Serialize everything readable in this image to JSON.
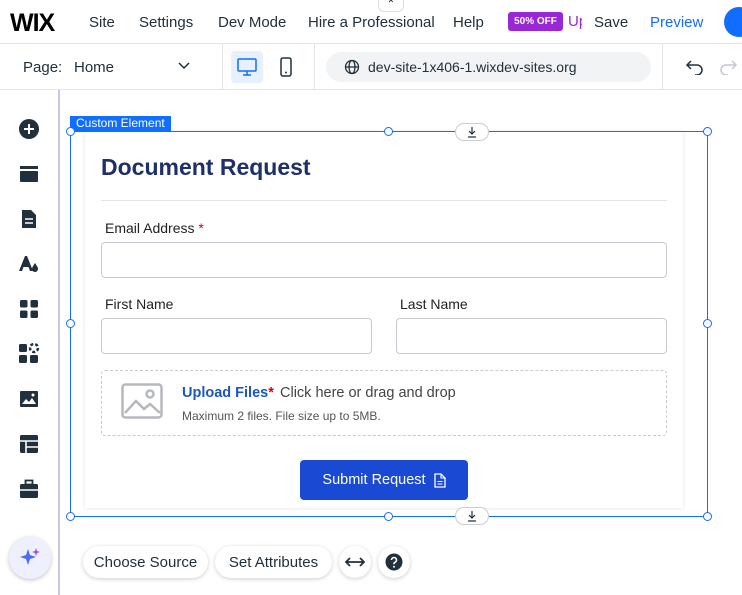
{
  "topbar": {
    "logo": "WIX",
    "menu": [
      "Site",
      "Settings",
      "Dev Mode",
      "Hire a Professional",
      "Help"
    ],
    "promo_badge": "50% OFF",
    "upgrade_label": "Upgrade",
    "save_label": "Save",
    "preview_label": "Preview",
    "collapse_glyph": "⌃"
  },
  "subbar": {
    "page_label": "Page:",
    "page_value": "Home",
    "url": "dev-site-1x406-1.wixdev-sites.org"
  },
  "selection": {
    "label": "Custom Element"
  },
  "form": {
    "title": "Document Request",
    "email_label": "Email Address",
    "required_mark": "*",
    "first_name_label": "First Name",
    "last_name_label": "Last Name",
    "upload_title": "Upload Files",
    "upload_hint": "Click here or drag and drop",
    "upload_limits": "Maximum 2 files.  File size up to 5MB.",
    "submit_label": "Submit Request"
  },
  "floating_toolbar": {
    "choose_source": "Choose Source",
    "set_attributes": "Set Attributes"
  },
  "colors": {
    "accent": "#116dff",
    "promo": "#9a27d5",
    "form_title": "#1e2f6b",
    "submit": "#1a49d3"
  },
  "icons": [
    "add-icon",
    "pages-icon",
    "blog-icon",
    "design-icon",
    "apps-icon",
    "business-apps-icon",
    "media-icon",
    "cms-icon",
    "portfolio-icon",
    "ai-sparkle-icon",
    "desktop-icon",
    "mobile-icon",
    "globe-icon",
    "undo-icon",
    "redo-icon",
    "stretch-icon",
    "help-icon",
    "image-placeholder-icon",
    "document-icon",
    "anchor-down-icon"
  ]
}
